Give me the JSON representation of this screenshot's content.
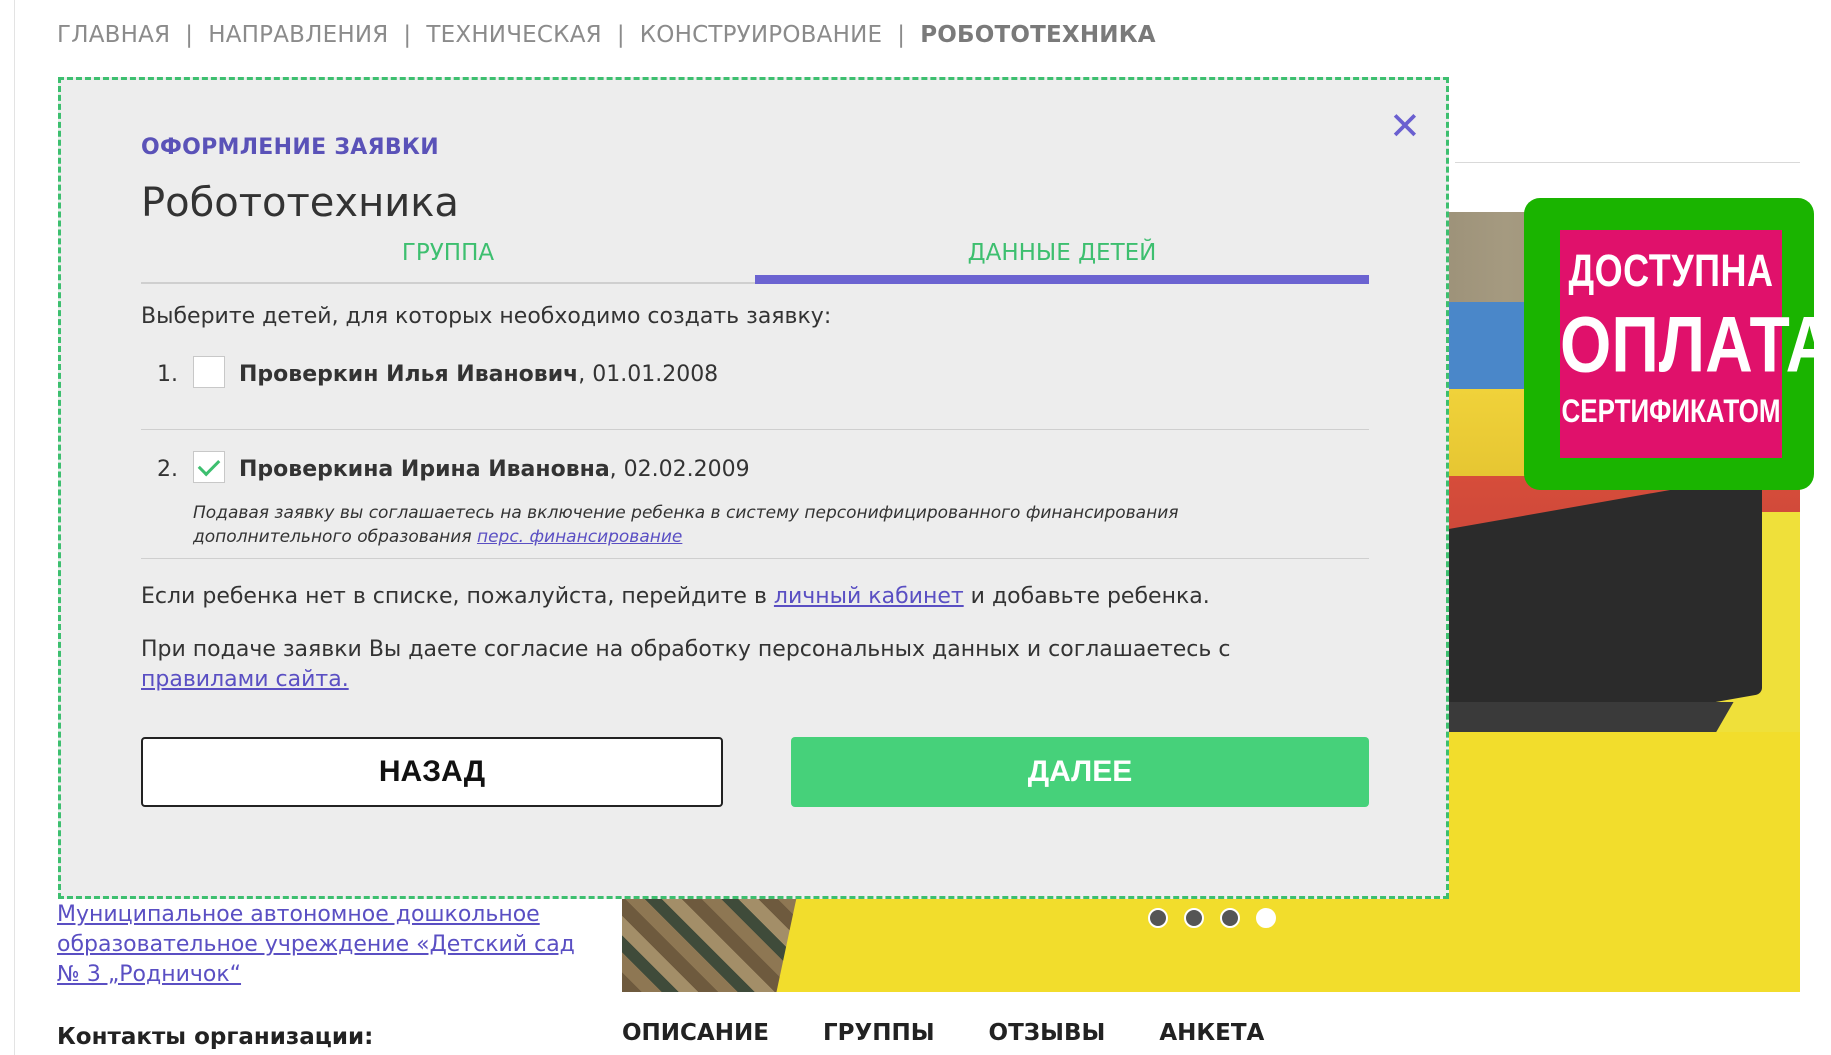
{
  "breadcrumb": {
    "items": [
      "ГЛАВНАЯ",
      "НАПРАВЛЕНИЯ",
      "ТЕХНИЧЕСКАЯ",
      "КОНСТРУИРОВАНИЕ"
    ],
    "current": "РОБОТОТЕХНИКА",
    "separator": "|"
  },
  "badge": {
    "line1": "ДОСТУПНА",
    "line2": "ОПЛАТА",
    "line3": "СЕРТИФИКАТОМ",
    "bg_color": "#1ab400",
    "inner_color": "#e0116b"
  },
  "organization": {
    "link_text": "Муниципальное автономное дошкольное образовательное учреждение «Детский сад № 3 „Родничок“",
    "contacts_label": "Контакты организации:"
  },
  "course_tabs": [
    "ОПИСАНИЕ",
    "ГРУППЫ",
    "ОТЗЫВЫ",
    "АНКЕТА"
  ],
  "slider": {
    "count": 4,
    "active_index": 4
  },
  "modal": {
    "subtitle": "ОФОРМЛЕНИЕ ЗАЯВКИ",
    "title": "Робототехника",
    "close_glyph": "✕",
    "steps": [
      {
        "label": "ГРУППА",
        "active": false
      },
      {
        "label": "ДАННЫЕ ДЕТЕЙ",
        "active": true
      }
    ],
    "instruction": "Выберите детей, для которых необходимо создать заявку:",
    "children": [
      {
        "num": "1.",
        "name": "Проверкин Илья Иванович",
        "dob": ", 01.01.2008",
        "checked": false
      },
      {
        "num": "2.",
        "name": "Проверкина Ирина Ивановна",
        "dob": ", 02.02.2009",
        "checked": true,
        "note": "Подавая заявку вы соглашаетесь на включение ребенка в систему персонифицированного финансирования дополнительного образования",
        "note_link": "перс. финансирование"
      }
    ],
    "missing_text_before": "Если ребенка нет в списке, пожалуйста, перейдите в ",
    "missing_link": "личный кабинет",
    "missing_text_after": " и добавьте ребенка.",
    "consent_text": "При подаче заявки Вы даете согласие на обработку персональных данных и соглашаетесь с ",
    "consent_link": "правилами сайта.",
    "back_label": "НАЗАД",
    "next_label": "ДАЛЕЕ",
    "accent_color": "#6b63d1",
    "green_color": "#46d17a"
  }
}
